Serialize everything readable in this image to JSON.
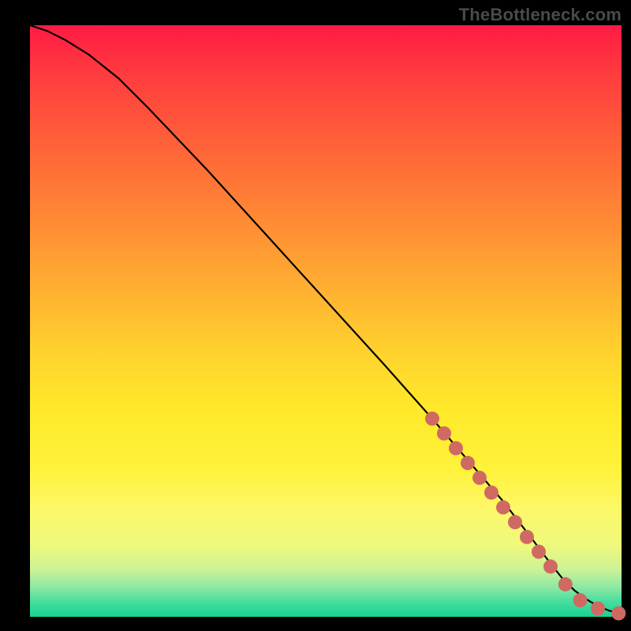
{
  "watermark": "TheBottleneck.com",
  "chart_data": {
    "type": "line",
    "title": "",
    "xlabel": "",
    "ylabel": "",
    "xlim": [
      0,
      100
    ],
    "ylim": [
      0,
      100
    ],
    "grid": false,
    "legend": false,
    "curve": {
      "name": "bottleneck-curve",
      "x": [
        0,
        3,
        6,
        10,
        15,
        20,
        30,
        40,
        50,
        60,
        68,
        74,
        80,
        85,
        88,
        90,
        92,
        94,
        96,
        98,
        100
      ],
      "y": [
        100,
        99,
        97.5,
        95,
        91,
        86,
        75.5,
        64.5,
        53.5,
        42.5,
        33.5,
        26.5,
        19.5,
        13,
        9,
        6.5,
        4.5,
        3,
        1.8,
        1,
        0.6
      ]
    },
    "highlight_points": {
      "name": "salmon-dots",
      "color": "#cf6a63",
      "x": [
        68,
        70,
        72,
        74,
        76,
        78,
        80,
        82,
        84,
        86,
        88,
        90.5,
        93,
        96,
        99.5
      ],
      "y": [
        33.5,
        31,
        28.5,
        26,
        23.5,
        21,
        18.5,
        16,
        13.5,
        11,
        8.5,
        5.5,
        2.8,
        1.4,
        0.6
      ]
    }
  }
}
